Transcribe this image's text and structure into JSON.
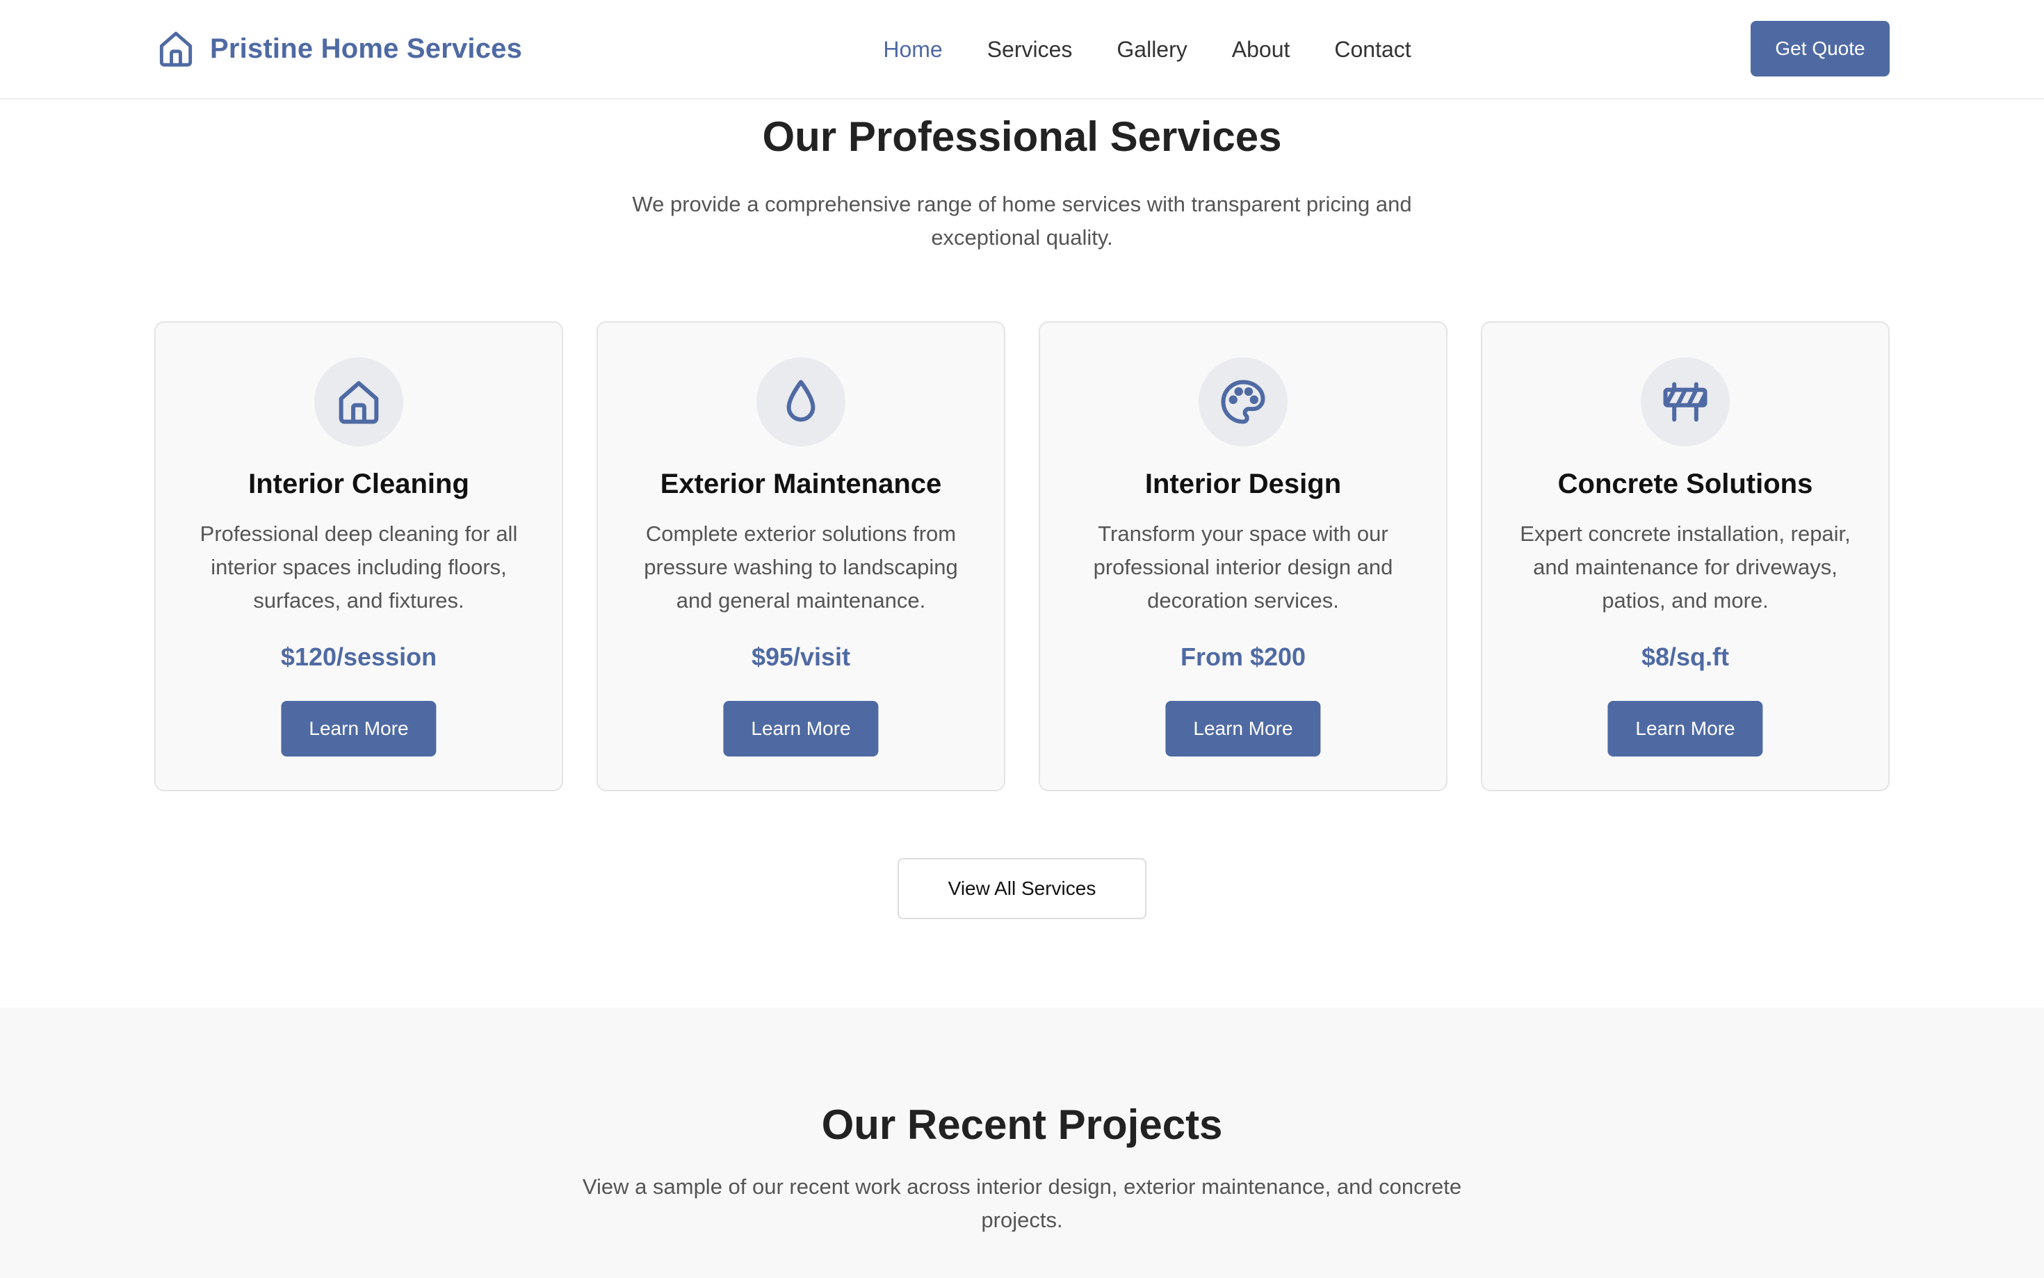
{
  "brand": {
    "name": "Pristine Home Services",
    "icon": "house-outline-icon"
  },
  "nav": {
    "items": [
      {
        "label": "Home",
        "active": true
      },
      {
        "label": "Services",
        "active": false
      },
      {
        "label": "Gallery",
        "active": false
      },
      {
        "label": "About",
        "active": false
      },
      {
        "label": "Contact",
        "active": false
      }
    ]
  },
  "header": {
    "cta_label": "Get Quote"
  },
  "services": {
    "title": "Our Professional Services",
    "subtitle": "We provide a comprehensive range of home services with transparent pricing and exceptional quality.",
    "cards": [
      {
        "icon": "house-icon",
        "title": "Interior Cleaning",
        "description": "Professional deep cleaning for all interior spaces including floors, surfaces, and fixtures.",
        "price": "$120/session",
        "button": "Learn More"
      },
      {
        "icon": "water-drop-icon",
        "title": "Exterior Maintenance",
        "description": "Complete exterior solutions from pressure washing to landscaping and general maintenance.",
        "price": "$95/visit",
        "button": "Learn More"
      },
      {
        "icon": "palette-icon",
        "title": "Interior Design",
        "description": "Transform your space with our professional interior design and decoration services.",
        "price": "From $200",
        "button": "Learn More"
      },
      {
        "icon": "construction-barrier-icon",
        "title": "Concrete Solutions",
        "description": "Expert concrete installation, repair, and maintenance for driveways, patios, and more.",
        "price": "$8/sq.ft",
        "button": "Learn More"
      }
    ],
    "view_all_label": "View All Services"
  },
  "projects": {
    "title": "Our Recent Projects",
    "subtitle": "View a sample of our recent work across interior design, exterior maintenance, and concrete projects."
  },
  "colors": {
    "accent": "#4f6aa3",
    "icon_bg": "#e9ebef",
    "card_bg": "#f9f9f9",
    "section_bg": "#f8f8f8"
  }
}
